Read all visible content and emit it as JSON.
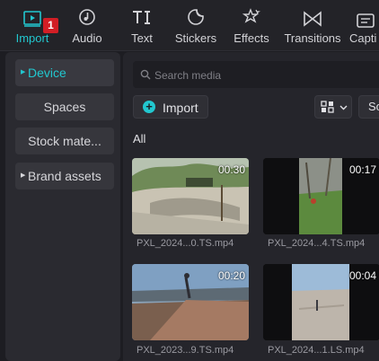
{
  "toolbar": {
    "tabs": [
      {
        "label": "Import",
        "icon": "import-icon",
        "active": true
      },
      {
        "label": "Audio",
        "icon": "audio-icon"
      },
      {
        "label": "Text",
        "icon": "text-icon"
      },
      {
        "label": "Stickers",
        "icon": "stickers-icon"
      },
      {
        "label": "Effects",
        "icon": "effects-icon"
      },
      {
        "label": "Transitions",
        "icon": "transitions-icon"
      },
      {
        "label": "Capti",
        "icon": "captions-icon"
      }
    ],
    "badge": "1",
    "accent": "#22c7cf"
  },
  "sidebar": {
    "items": [
      {
        "label": "Device",
        "active": true
      },
      {
        "label": "Spaces"
      },
      {
        "label": "Stock mate..."
      },
      {
        "label": "Brand assets"
      }
    ]
  },
  "main": {
    "search": {
      "placeholder": "Search media"
    },
    "import_label": "Import",
    "sort_label": "So",
    "filter_label": "All",
    "media": [
      {
        "name": "PXL_2024...0.TS.mp4",
        "duration": "00:30"
      },
      {
        "name": "PXL_2024...4.TS.mp4",
        "duration": "00:17"
      },
      {
        "name": "PXL_2023...9.TS.mp4",
        "duration": "00:20"
      },
      {
        "name": "PXL_2024...1.LS.mp4",
        "duration": "00:04"
      }
    ]
  }
}
